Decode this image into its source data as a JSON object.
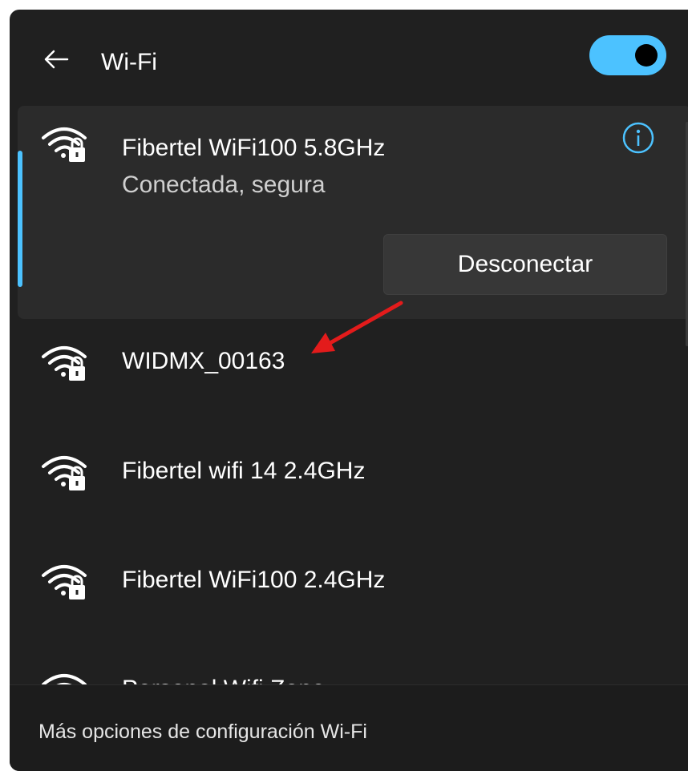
{
  "header": {
    "title": "Wi-Fi",
    "back_icon": "arrow-left-icon",
    "toggle_state": "on"
  },
  "connected": {
    "name": "Fibertel WiFi100 5.8GHz",
    "status": "Conectada, segura",
    "disconnect_label": "Desconectar",
    "info_icon": "info-icon"
  },
  "networks": [
    {
      "name": "WIDMX_00163",
      "icon": "wifi-secured-icon"
    },
    {
      "name": "Fibertel wifi 14 2.4GHz",
      "icon": "wifi-secured-icon"
    },
    {
      "name": "Fibertel WiFi100 2.4GHz",
      "icon": "wifi-secured-icon"
    },
    {
      "name": "Personal Wifi Zone",
      "icon": "wifi-secured-icon"
    }
  ],
  "footer": {
    "more_settings": "Más opciones de configuración Wi-Fi"
  },
  "colors": {
    "accent": "#4cc2ff",
    "panel": "#202020",
    "annotation_arrow": "#e31b1b"
  }
}
